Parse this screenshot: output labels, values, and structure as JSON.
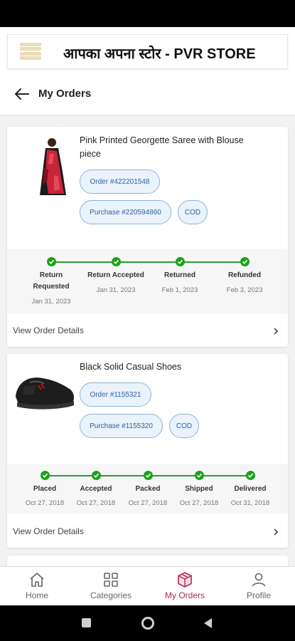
{
  "store": {
    "title": "आपका अपना स्टोर - PVR STORE"
  },
  "page": {
    "title": "My Orders"
  },
  "orders": [
    {
      "product_name": "Pink Printed Georgette Saree with Blouse piece",
      "order_label": "Order #422201548",
      "purchase_label": "Purchase #220594860",
      "payment": "COD",
      "steps": [
        {
          "label": "Return Requested",
          "date": "Jan 31, 2023"
        },
        {
          "label": "Return Accepted",
          "date": "Jan 31, 2023"
        },
        {
          "label": "Returned",
          "date": "Feb 1, 2023"
        },
        {
          "label": "Refunded",
          "date": "Feb 3, 2023"
        }
      ],
      "details_label": "View Order Details"
    },
    {
      "product_name": "Black Solid Casual Shoes",
      "order_label": "Order #1155321",
      "purchase_label": "Purchase #1155320",
      "payment": "COD",
      "steps": [
        {
          "label": "Placed",
          "date": "Oct 27, 2018"
        },
        {
          "label": "Accepted",
          "date": "Oct 27, 2018"
        },
        {
          "label": "Packed",
          "date": "Oct 27, 2018"
        },
        {
          "label": "Shipped",
          "date": "Oct 27, 2018"
        },
        {
          "label": "Delivered",
          "date": "Oct 31, 2018"
        }
      ],
      "details_label": "View Order Details"
    }
  ],
  "nav": {
    "items": [
      {
        "label": "Home",
        "icon": "home-icon"
      },
      {
        "label": "Categories",
        "icon": "grid-icon"
      },
      {
        "label": "My Orders",
        "icon": "package-icon",
        "active": true
      },
      {
        "label": "Profile",
        "icon": "person-icon"
      }
    ]
  },
  "colors": {
    "accent": "#b0295a",
    "status_green": "#1aa31a",
    "pill_blue": "#2d62a3"
  }
}
